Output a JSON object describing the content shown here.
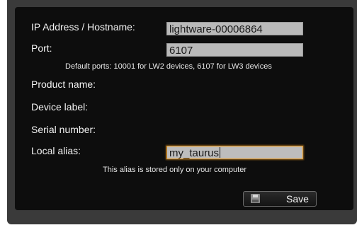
{
  "form": {
    "ip_label": "IP Address / Hostname:",
    "ip_value": "lightware-00006864",
    "port_label": "Port:",
    "port_value": "6107",
    "port_hint": "Default ports: 10001 for LW2 devices, 6107 for LW3 devices",
    "product_label": "Product name:",
    "device_label_label": "Device label:",
    "serial_label": "Serial number:",
    "alias_label": "Local alias:",
    "alias_value": "my_taurus",
    "alias_hint": "This alias is stored only on your computer",
    "save_label": "Save",
    "save_icon": "floppy-disk-icon",
    "focus_color": "#e09320"
  }
}
